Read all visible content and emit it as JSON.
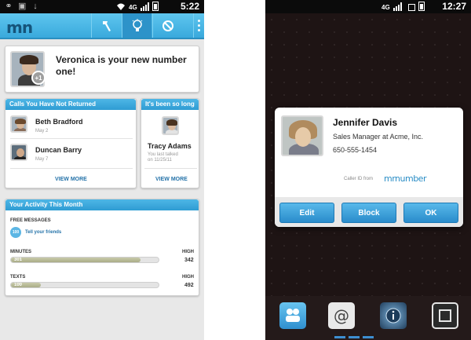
{
  "left_phone": {
    "status_bar": {
      "network": "4G",
      "time": "5:22"
    },
    "action_bar": {
      "logo": "mn"
    },
    "hero": {
      "message": "Veronica is your new number one!",
      "badge": "+1"
    },
    "calls_card": {
      "header": "Calls You Have Not Returned",
      "items": [
        {
          "name": "Beth Bradford",
          "date": "May 2"
        },
        {
          "name": "Duncan Barry",
          "date": "May 7"
        }
      ],
      "view_more": "VIEW MORE"
    },
    "long_card": {
      "header": "It's been so long",
      "name": "Tracy Adams",
      "last_talked_line1": "You last talked",
      "last_talked_line2": "on 11/25/11",
      "view_more": "VIEW MORE"
    },
    "activity_card": {
      "header": "Your Activity This Month",
      "free_label": "FREE MESSAGES",
      "free_badge": "100",
      "tell_friends": "Tell your friends",
      "high_label": "HIGH",
      "minutes": {
        "label": "MINUTES",
        "value": "301",
        "high": "342",
        "fraction": 0.88
      },
      "texts": {
        "label": "TEXTS",
        "value": "100",
        "high": "492",
        "fraction": 0.2
      }
    }
  },
  "right_phone": {
    "status_bar": {
      "network": "4G",
      "time": "12:27"
    },
    "dialog": {
      "name": "Jennifer Davis",
      "title": "Sales Manager at Acme, Inc.",
      "phone": "650-555-1454",
      "caller_id": "Caller ID from",
      "brand": "mrnumber",
      "buttons": {
        "edit": "Edit",
        "block": "Block",
        "ok": "OK"
      }
    }
  }
}
